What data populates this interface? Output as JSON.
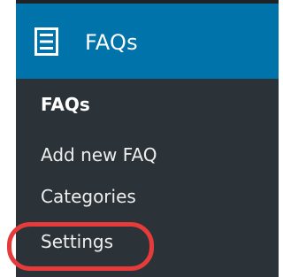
{
  "colors": {
    "menu_background": "#2c3338",
    "header_background": "#0073aa",
    "header_text": "#ffffff",
    "submenu_text": "#eeeeee",
    "annotation_circle": "#e63b3b"
  },
  "header": {
    "icon": "list-icon",
    "title": "FAQs"
  },
  "submenu": {
    "items": [
      {
        "label": "FAQs",
        "current": true
      },
      {
        "label": "Add new FAQ",
        "current": false
      },
      {
        "label": "Categories",
        "current": false
      },
      {
        "label": "Settings",
        "current": false,
        "highlighted": true
      }
    ]
  }
}
